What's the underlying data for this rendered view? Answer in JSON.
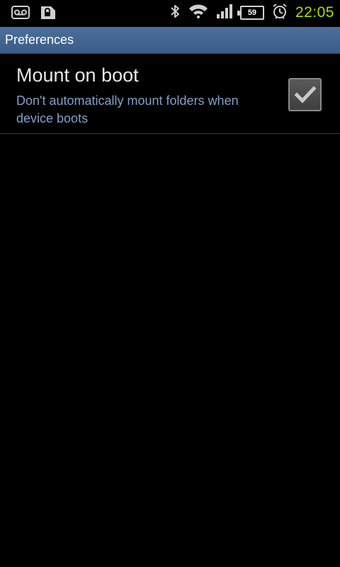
{
  "status_bar": {
    "icons_left": [
      "voicemail-icon",
      "sd-card-icon"
    ],
    "icons_right": [
      "bluetooth-icon",
      "wifi-icon",
      "signal-icon",
      "battery-icon",
      "alarm-icon"
    ],
    "battery_level": "59",
    "time": "22:05",
    "clock_color": "#a8e000"
  },
  "title_bar": {
    "title": "Preferences",
    "color": "#3f628c"
  },
  "preference": {
    "title": "Mount on boot",
    "summary": "Don't automatically mount folders when device boots",
    "checked": true,
    "summary_color": "#7fa1c9"
  }
}
